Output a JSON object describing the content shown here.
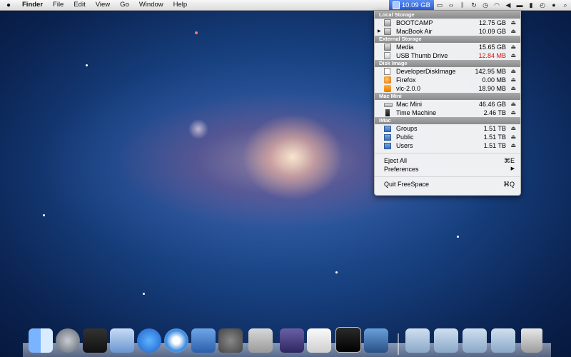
{
  "menubar": {
    "app_name": "Finder",
    "items": [
      "File",
      "Edit",
      "View",
      "Go",
      "Window",
      "Help"
    ],
    "freespace_value": "10.09 GB"
  },
  "dropdown": {
    "sections": [
      {
        "header": "Local Storage",
        "rows": [
          {
            "name": "BOOTCAMP",
            "size": "12.75 GB",
            "icon": "hard-disk-icon"
          },
          {
            "name": "MacBook Air",
            "size": "10.09 GB",
            "icon": "hard-disk-icon",
            "expandable": true
          }
        ]
      },
      {
        "header": "External Storage",
        "rows": [
          {
            "name": "Media",
            "size": "15.65 GB",
            "icon": "hard-disk-icon"
          },
          {
            "name": "USB Thumb Drive",
            "size": "12.84 MB",
            "icon": "usb-drive-icon",
            "warning": true
          }
        ]
      },
      {
        "header": "Disk Image",
        "rows": [
          {
            "name": "DeveloperDiskImage",
            "size": "142.95 MB",
            "icon": "disk-image-icon"
          },
          {
            "name": "Firefox",
            "size": "0.00 MB",
            "icon": "firefox-icon"
          },
          {
            "name": "vlc-2.0.0",
            "size": "18.90 MB",
            "icon": "vlc-icon"
          }
        ]
      },
      {
        "header": "Mac Mini",
        "rows": [
          {
            "name": "Mac Mini",
            "size": "46.46 GB",
            "icon": "mac-mini-icon"
          },
          {
            "name": "Time Machine",
            "size": "2.46 TB",
            "icon": "time-machine-icon"
          }
        ]
      },
      {
        "header": "iMac",
        "rows": [
          {
            "name": "Groups",
            "size": "1.51 TB",
            "icon": "shared-folder-icon"
          },
          {
            "name": "Public",
            "size": "1.51 TB",
            "icon": "shared-folder-icon"
          },
          {
            "name": "Users",
            "size": "1.51 TB",
            "icon": "shared-folder-icon"
          }
        ]
      }
    ],
    "eject_symbol": "⏏",
    "commands": {
      "eject_all": "Eject All",
      "eject_all_shortcut": "⌘E",
      "preferences": "Preferences",
      "preferences_arrow": "▶",
      "quit": "Quit FreeSpace",
      "quit_shortcut": "⌘Q"
    }
  },
  "dock": {
    "apps": [
      "finder-icon",
      "launchpad-icon",
      "mission-control-icon",
      "mail-icon",
      "app-store-icon",
      "safari-icon",
      "xcode-icon",
      "system-preferences-icon",
      "calculator-icon",
      "preview-icon",
      "textedit-icon",
      "terminal-icon",
      "photo-booth-icon",
      "applications-folder-icon",
      "documents-folder-icon",
      "downloads-folder-icon",
      "trash-icon"
    ]
  },
  "colors": {
    "accent": "#2a5ed8",
    "warning": "#e01010"
  }
}
